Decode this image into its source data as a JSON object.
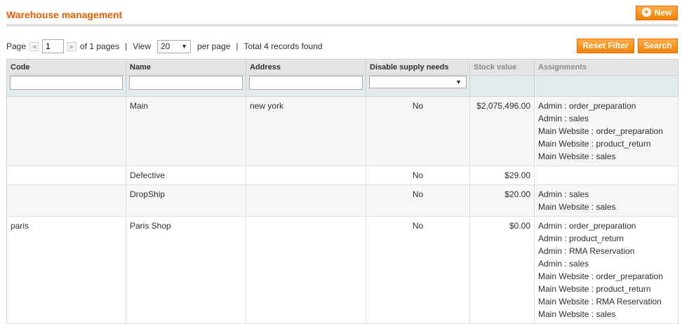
{
  "header": {
    "title": "Warehouse management",
    "new_button": "New"
  },
  "pager": {
    "page_label": "Page",
    "page_value": "1",
    "of_pages": "of 1 pages",
    "view_label": "View",
    "per_page_value": "20",
    "per_page_label": "per page",
    "total": "Total 4 records found",
    "reset_filter": "Reset Filter",
    "search": "Search"
  },
  "grid": {
    "columns": [
      "Code",
      "Name",
      "Address",
      "Disable supply needs",
      "Stock value",
      "Assignments"
    ],
    "rows": [
      {
        "code": "",
        "name": "Main",
        "address": "new york",
        "disable": "No",
        "stock": "$2,075,496.00",
        "assignments": [
          "Admin : order_preparation",
          "Admin : sales",
          "Main Website : order_preparation",
          "Main Website : product_return",
          "Main Website : sales"
        ]
      },
      {
        "code": "",
        "name": "Defective",
        "address": "",
        "disable": "No",
        "stock": "$29.00",
        "assignments": []
      },
      {
        "code": "",
        "name": "DropShip",
        "address": "",
        "disable": "No",
        "stock": "$20.00",
        "assignments": [
          "Admin : sales",
          "Main Website : sales"
        ]
      },
      {
        "code": "paris",
        "name": "Paris Shop",
        "address": "",
        "disable": "No",
        "stock": "$0.00",
        "assignments": [
          "Admin : order_preparation",
          "Admin : product_return",
          "Admin : RMA Reservation",
          "Admin : sales",
          "Main Website : order_preparation",
          "Main Website : product_return",
          "Main Website : RMA Reservation",
          "Main Website : sales"
        ]
      }
    ]
  },
  "colors": {
    "accent": "#eb5e00",
    "button": "#f18200"
  }
}
